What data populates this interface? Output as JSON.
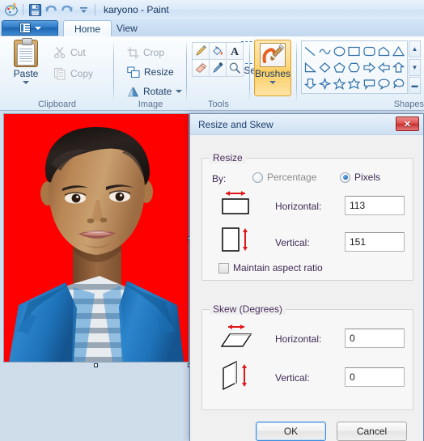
{
  "window": {
    "title": "karyono - Paint",
    "quick_access": [
      {
        "name": "paint-app-icon",
        "label": "Paint"
      },
      {
        "name": "save-icon",
        "label": "Save"
      },
      {
        "name": "undo-icon",
        "label": "Undo"
      },
      {
        "name": "redo-icon",
        "label": "Redo"
      },
      {
        "name": "customize-quick-access-icon",
        "label": "Customize Quick Access Toolbar"
      }
    ]
  },
  "ribbon": {
    "file_button_label": "",
    "tabs": [
      {
        "label": "Home",
        "active": true
      },
      {
        "label": "View",
        "active": false
      }
    ],
    "groups": [
      {
        "name": "clipboard",
        "label": "Clipboard",
        "items": [
          {
            "label": "Paste",
            "icon": "clipboard-icon",
            "enabled": true
          },
          {
            "label": "Cut",
            "icon": "scissors-icon",
            "enabled": false
          },
          {
            "label": "Copy",
            "icon": "copy-icon",
            "enabled": false
          }
        ]
      },
      {
        "name": "image",
        "label": "Image",
        "items": [
          {
            "label": "Select",
            "icon": "select-marquee-icon",
            "enabled": true
          },
          {
            "label": "Crop",
            "icon": "crop-icon",
            "enabled": false
          },
          {
            "label": "Resize",
            "icon": "resize-icon",
            "enabled": true
          },
          {
            "label": "Rotate",
            "icon": "rotate-icon",
            "enabled": true
          }
        ]
      },
      {
        "name": "tools",
        "label": "Tools",
        "items": [
          {
            "label": "Pencil",
            "icon": "pencil-icon"
          },
          {
            "label": "Fill with color",
            "icon": "paint-bucket-icon"
          },
          {
            "label": "Text",
            "icon": "text-a-icon"
          },
          {
            "label": "Eraser",
            "icon": "eraser-icon"
          },
          {
            "label": "Color picker",
            "icon": "eyedropper-icon"
          },
          {
            "label": "Magnifier",
            "icon": "magnifier-icon"
          }
        ]
      },
      {
        "name": "brushes",
        "label": "Brushes",
        "button_label": "Brushes",
        "highlighted": true,
        "accent": "#fbcd62"
      },
      {
        "name": "shapes",
        "label": "Shapes",
        "items": [
          "line",
          "curve",
          "oval",
          "rectangle",
          "rounded-rectangle",
          "polygon",
          "triangle",
          "right-triangle",
          "diamond",
          "pentagon",
          "hexagon",
          "right-arrow",
          "left-arrow",
          "up-arrow",
          "down-arrow",
          "four-point-star",
          "five-point-star",
          "six-point-star",
          "rounded-callout",
          "oval-callout",
          "cloud-callout"
        ],
        "scroll_buttons": [
          "scroll-up",
          "scroll-down",
          "open-gallery"
        ]
      }
    ]
  },
  "canvas": {
    "name": "paint-canvas",
    "background_color": "#fe0000",
    "description": "Portrait photograph of a man in a blue jacket over a white and grey striped shirt on a red background",
    "handles": [
      "bottom-center-handle",
      "bottom-right-handle",
      "middle-right-handle"
    ]
  },
  "dialog": {
    "title": "Resize and Skew",
    "close_label": "✕",
    "resize": {
      "legend": "Resize",
      "by_label": "By:",
      "options": [
        {
          "label": "Percentage",
          "selected": false
        },
        {
          "label": "Pixels",
          "selected": true
        }
      ],
      "fields": [
        {
          "label": "Horizontal:",
          "value": "113",
          "icon": "horizontal-resize-icon"
        },
        {
          "label": "Vertical:",
          "value": "151",
          "icon": "vertical-resize-icon"
        }
      ],
      "maintain_aspect_ratio": {
        "label": "Maintain aspect ratio",
        "checked": false
      }
    },
    "skew": {
      "legend": "Skew (Degrees)",
      "fields": [
        {
          "label": "Horizontal:",
          "value": "0",
          "icon": "horizontal-skew-icon"
        },
        {
          "label": "Vertical:",
          "value": "0",
          "icon": "vertical-skew-icon"
        }
      ]
    },
    "buttons": [
      {
        "label": "OK",
        "default": true
      },
      {
        "label": "Cancel",
        "default": false
      }
    ]
  }
}
